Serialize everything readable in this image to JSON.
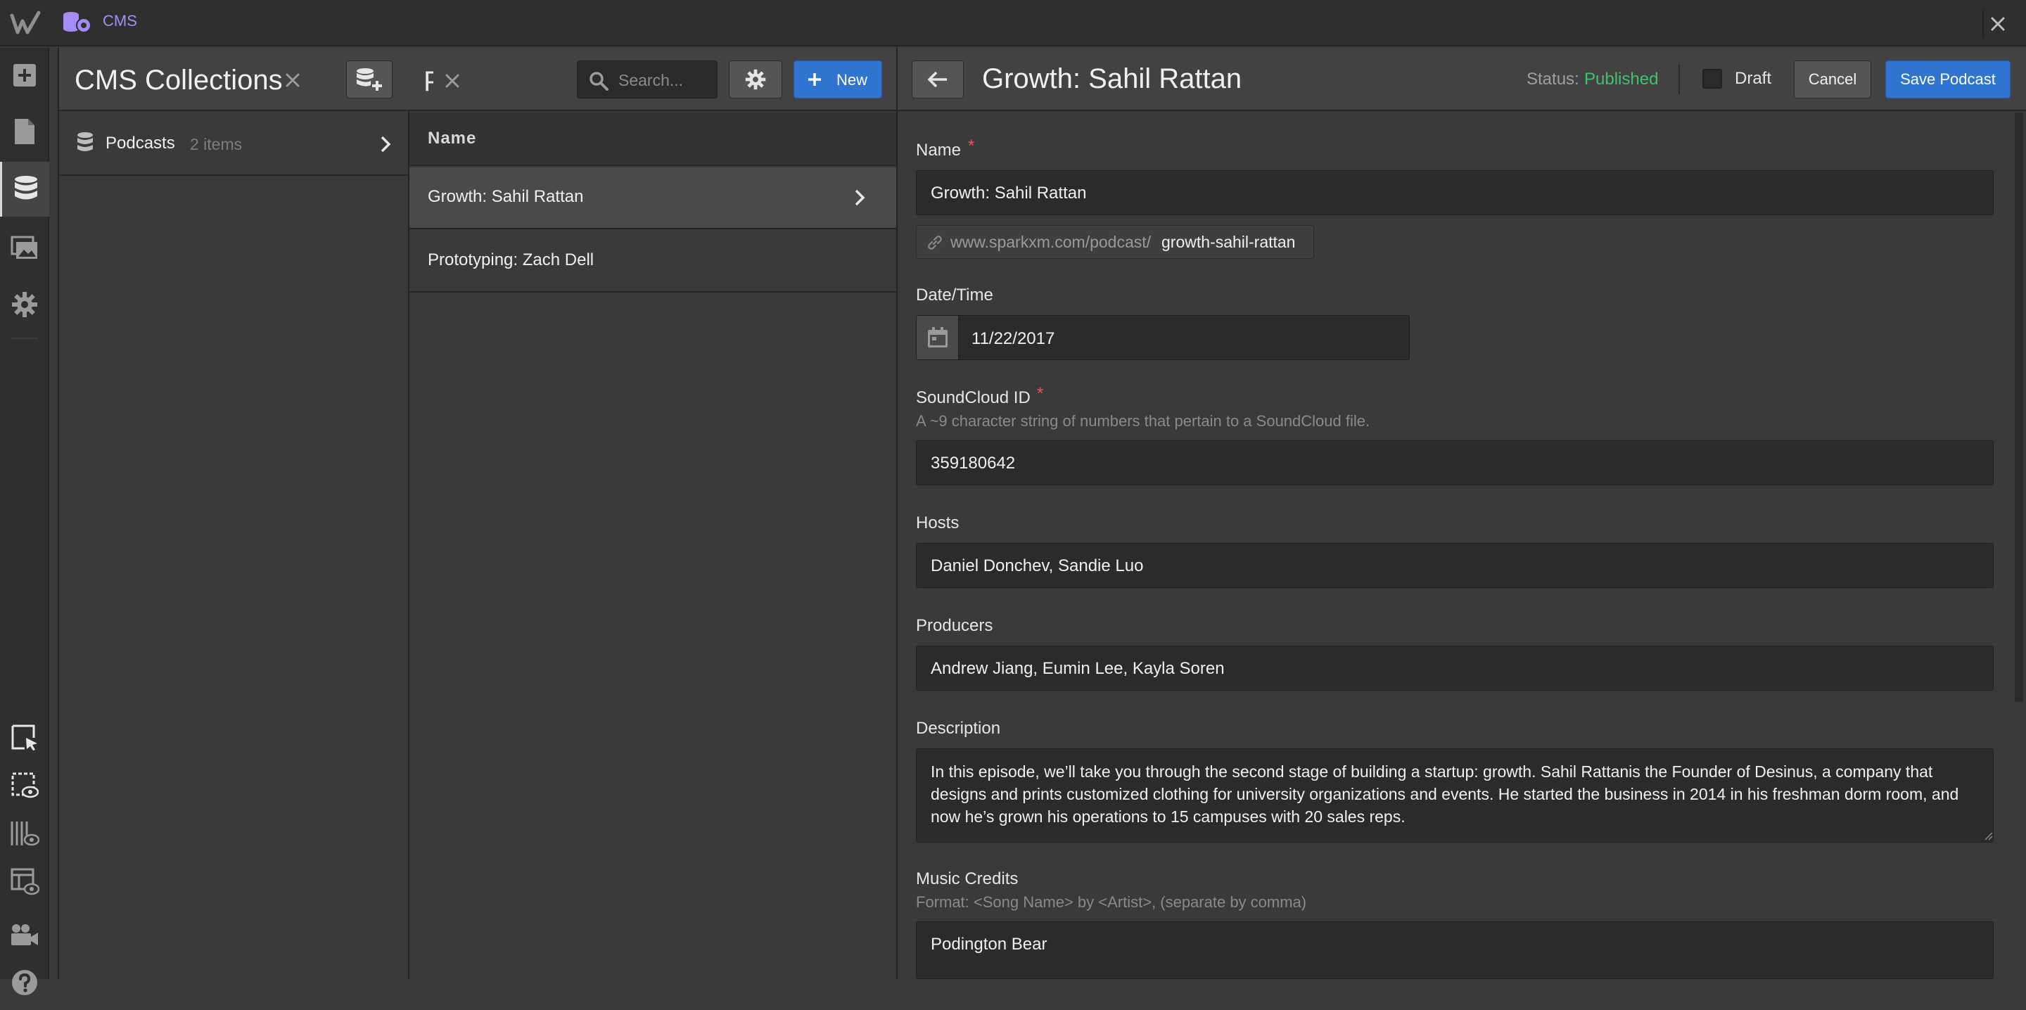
{
  "app": {
    "section_label": "CMS",
    "colors": {
      "accent_blue": "#2f74d0",
      "published_green": "#3dc26f",
      "cms_purple": "#a58cf5",
      "required_red": "#e85555"
    }
  },
  "rail": {
    "items": [
      {
        "icon": "add-icon"
      },
      {
        "icon": "pages-icon"
      },
      {
        "icon": "database-icon",
        "active": true
      },
      {
        "icon": "assets-icon"
      },
      {
        "icon": "settings-icon"
      },
      {
        "icon": "select-element-icon"
      },
      {
        "icon": "preview-icon"
      },
      {
        "icon": "grid-preview-icon"
      },
      {
        "icon": "layout-preview-icon"
      },
      {
        "icon": "video-icon"
      },
      {
        "icon": "help-icon"
      }
    ]
  },
  "collections_panel": {
    "title": "CMS Collections",
    "items": [
      {
        "label": "Podcasts",
        "count": "2 items"
      }
    ]
  },
  "items_panel": {
    "title_truncated": "Podcasts",
    "search_placeholder": "Search...",
    "new_label": "New",
    "column_header": "Name",
    "rows": [
      {
        "label": "Growth: Sahil Rattan",
        "selected": true
      },
      {
        "label": "Prototyping: Zach Dell",
        "selected": false
      }
    ]
  },
  "editor": {
    "title": "Growth: Sahil Rattan",
    "status_label": "Status:",
    "status_value": "Published",
    "draft_label": "Draft",
    "cancel_label": "Cancel",
    "save_label": "Save Podcast",
    "fields": {
      "name": {
        "label": "Name",
        "required": "*",
        "value": "Growth: Sahil Rattan"
      },
      "slug": {
        "prefix": "www.sparkxm.com/podcast/",
        "value": "growth-sahil-rattan"
      },
      "datetime": {
        "label": "Date/Time",
        "value": "11/22/2017"
      },
      "soundcloud": {
        "label": "SoundCloud ID",
        "required": "*",
        "help": "A ~9 character string of numbers that pertain to a SoundCloud file.",
        "value": "359180642"
      },
      "hosts": {
        "label": "Hosts",
        "value": "Daniel Donchev, Sandie Luo"
      },
      "producers": {
        "label": "Producers",
        "value": "Andrew Jiang, Eumin Lee, Kayla Soren"
      },
      "description": {
        "label": "Description",
        "value": "In this episode, we’ll take you through the second stage of building a startup: growth. Sahil Rattanis the Founder of Desinus, a company that designs and prints customized clothing for university organizations and events. He started the business in 2014 in his freshman dorm room, and now he’s grown his operations to 15 campuses with 20 sales reps."
      },
      "music_credits": {
        "label": "Music Credits",
        "help": "Format: <Song Name> by <Artist>, (separate by comma)",
        "value": "Podington Bear"
      }
    }
  }
}
